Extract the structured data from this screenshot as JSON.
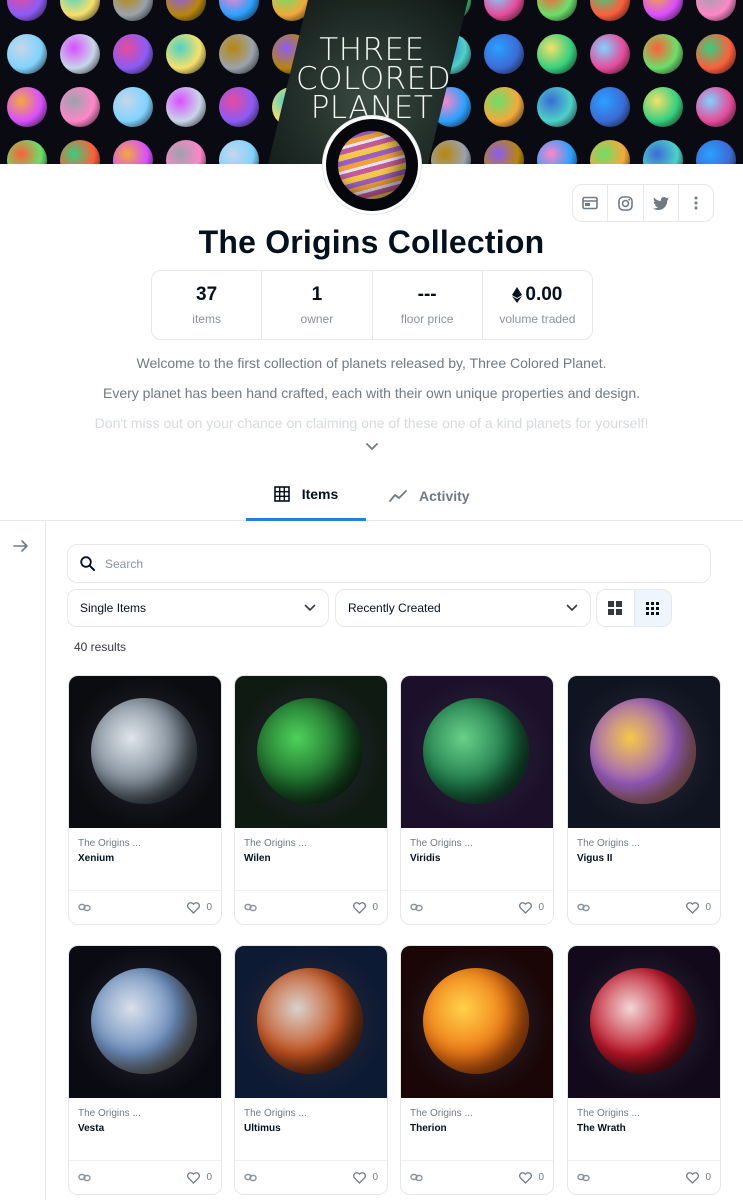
{
  "banner": {
    "title_lines": [
      "THREE",
      "COLORED",
      "PLANET"
    ]
  },
  "collection": {
    "name": "The Origins Collection"
  },
  "stats": [
    {
      "value": "37",
      "label": "items"
    },
    {
      "value": "1",
      "label": "owner"
    },
    {
      "value": "---",
      "label": "floor price"
    },
    {
      "value": "0.00",
      "label": "volume traded",
      "icon": "ethereum-icon"
    }
  ],
  "socials": [
    {
      "icon": "website-icon"
    },
    {
      "icon": "instagram-icon"
    },
    {
      "icon": "twitter-icon"
    },
    {
      "icon": "more-icon"
    }
  ],
  "description": [
    "Welcome to the first collection of planets released by, Three Colored Planet.",
    "Every planet has been hand crafted, each with their own unique properties and design.",
    "Don't miss out on your chance on claiming one of these one of a kind planets for yourself!"
  ],
  "tabs": {
    "items": "Items",
    "activity": "Activity"
  },
  "search": {
    "placeholder": "Search",
    "value": ""
  },
  "filters": {
    "type_select": "Single Items",
    "sort_select": "Recently Created"
  },
  "results": "40 results",
  "cards": [
    {
      "collection": "The Origins ...",
      "name": "Xenium",
      "likes": "0",
      "colors": [
        "#dfe6ec",
        "#7e8a96",
        "#151b24"
      ],
      "bg": "#0b0c0f"
    },
    {
      "collection": "The Origins ...",
      "name": "Wilen",
      "likes": "0",
      "colors": [
        "#4fd15a",
        "#1d6a2c",
        "#0a120c"
      ],
      "bg": "#0f1a12"
    },
    {
      "collection": "The Origins ...",
      "name": "Viridis",
      "likes": "0",
      "colors": [
        "#69d08a",
        "#1f7a4a",
        "#0b2a1d"
      ],
      "bg": "#1b0f2a"
    },
    {
      "collection": "The Origins ...",
      "name": "Vigus II",
      "likes": "0",
      "colors": [
        "#f5c84b",
        "#9b5ec4",
        "#f0a23a"
      ],
      "bg": "#101320"
    },
    {
      "collection": "The Origins ...",
      "name": "Vesta",
      "likes": "0",
      "colors": [
        "#d8e0ea",
        "#6d8fbf",
        "#8a6a3c"
      ],
      "bg": "#0a0a12"
    },
    {
      "collection": "The Origins ...",
      "name": "Ultimus",
      "likes": "0",
      "colors": [
        "#d9d2cc",
        "#c4531f",
        "#3a1a10"
      ],
      "bg": "#0d1a33"
    },
    {
      "collection": "The Origins ...",
      "name": "Therion",
      "likes": "0",
      "colors": [
        "#ffd24a",
        "#f07a16",
        "#c23a08"
      ],
      "bg": "#1a0606"
    },
    {
      "collection": "The Origins ...",
      "name": "The Wrath",
      "likes": "0",
      "colors": [
        "#f2d6d6",
        "#c0182b",
        "#2a0509"
      ],
      "bg": "#120a1a"
    }
  ]
}
